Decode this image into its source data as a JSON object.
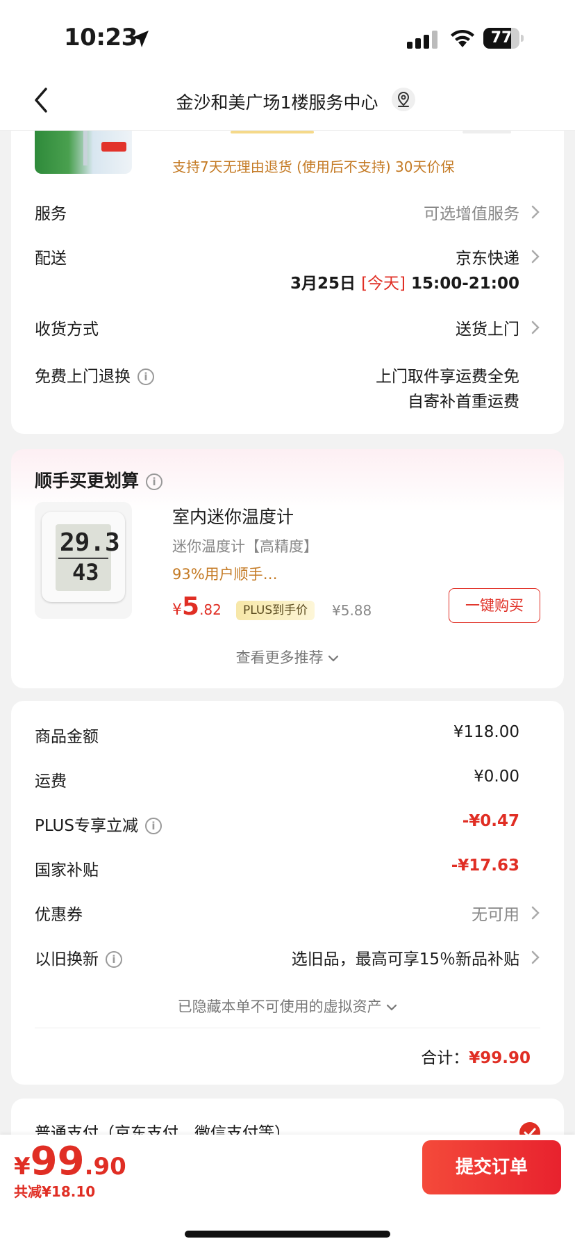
{
  "status_bar": {
    "time": "10:23",
    "battery": "77",
    "battery_level": 0.77
  },
  "nav": {
    "title": "金沙和美广场1楼服务中心"
  },
  "product_summary": {
    "return_policy": "支持7天无理由退货 (使用后不支持)   30天价保"
  },
  "order_info": {
    "service_label": "服务",
    "service_value": "可选增值服务",
    "delivery_label": "配送",
    "delivery_value": "京东快递",
    "delivery_date": "3月25日",
    "delivery_today": "[今天]",
    "delivery_time": "15:00-21:00",
    "receive_label": "收货方式",
    "receive_value": "送货上门",
    "free_return_label": "免费上门退换",
    "free_return_line1": "上门取件享运费全免",
    "free_return_line2": "自寄补首重运费"
  },
  "addon": {
    "title": "顺手买更划算",
    "product_name": "室内迷你温度计",
    "product_spec": "迷你温度计【高精度】",
    "product_rate": "93%用户顺手…",
    "price_cur": "¥",
    "price_int": "5",
    "price_dec": ".82",
    "plus_tag": "PLUS到手价",
    "old_price": "¥5.88",
    "buy_button": "一键购买",
    "more": "查看更多推荐",
    "thermo_temp": "29.3",
    "thermo_hum": "43"
  },
  "amounts": {
    "goods_label": "商品金额",
    "goods_value": "¥118.00",
    "shipping_label": "运费",
    "shipping_value": "¥0.00",
    "plus_label": "PLUS专享立减",
    "plus_value": "-¥0.47",
    "subsidy_label": "国家补贴",
    "subsidy_value": "-¥17.63",
    "coupon_label": "优惠券",
    "coupon_value": "无可用",
    "tradein_label": "以旧换新",
    "tradein_value": "选旧品，最高可享15％新品补贴",
    "hidden_assets": "已隐藏本单不可使用的虚拟资产",
    "total_label": "合计：",
    "total_value": "¥99.90"
  },
  "payment": {
    "method": "普通支付（京东支付、微信支付等）"
  },
  "bottom": {
    "price_cur": "¥",
    "price_int": "99",
    "price_dec": ".90",
    "saving": "共减¥18.10",
    "submit": "提交订单"
  },
  "colors": {
    "accent": "#e02e24",
    "gold": "#c47a24"
  }
}
